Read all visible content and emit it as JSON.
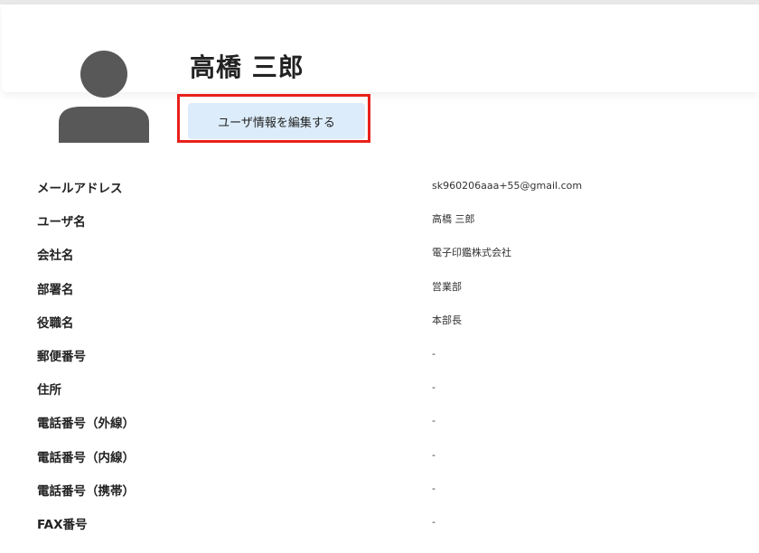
{
  "profile": {
    "name": "高橋 三郎",
    "edit_button_label": "ユーザ情報を編集する",
    "avatar_icon": "user-silhouette-icon"
  },
  "fields": [
    {
      "label": "メールアドレス",
      "value": "sk960206aaa+55@gmail.com"
    },
    {
      "label": "ユーザ名",
      "value": "高橋 三郎"
    },
    {
      "label": "会社名",
      "value": "電子印鑑株式会社"
    },
    {
      "label": "部署名",
      "value": "営業部"
    },
    {
      "label": "役職名",
      "value": "本部長"
    },
    {
      "label": "郵便番号",
      "value": "-"
    },
    {
      "label": "住所",
      "value": "-"
    },
    {
      "label": "電話番号（外線）",
      "value": "-"
    },
    {
      "label": "電話番号（内線）",
      "value": "-"
    },
    {
      "label": "電話番号（携帯）",
      "value": "-"
    },
    {
      "label": "FAX番号",
      "value": "-"
    }
  ],
  "colors": {
    "highlight_border": "#e8211c",
    "button_background": "#dcecfa",
    "avatar_fill": "#585858"
  }
}
